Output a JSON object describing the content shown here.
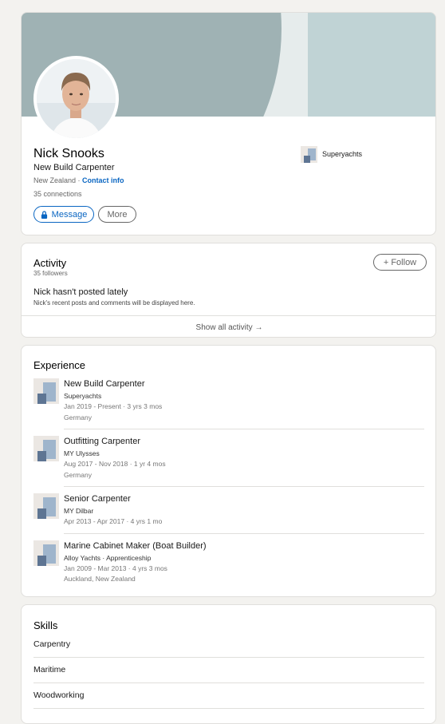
{
  "profile": {
    "name": "Nick Snooks",
    "headline": "New Build Carpenter",
    "location": "New Zealand",
    "location_separator": " · ",
    "contact_info": "Contact info",
    "connections": "35 connections",
    "message_label": "Message",
    "more_label": "More",
    "company": "Superyachts"
  },
  "activity": {
    "title": "Activity",
    "followers": "35 followers",
    "follow_label": "+ Follow",
    "no_posts_title": "Nick hasn't posted lately",
    "no_posts_text": "Nick's recent posts and comments will be displayed here.",
    "show_all": "Show all activity →"
  },
  "experience": {
    "title": "Experience",
    "items": [
      {
        "title": "New Build Carpenter",
        "company": "Superyachts",
        "dates": "Jan 2019 - Present · 3 yrs 3 mos",
        "location": "Germany"
      },
      {
        "title": "Outfitting Carpenter",
        "company": "MY Ulysses",
        "dates": "Aug 2017 - Nov 2018 · 1 yr 4 mos",
        "location": "Germany"
      },
      {
        "title": "Senior Carpenter",
        "company": "MY Dilbar",
        "dates": "Apr 2013 - Apr 2017 · 4 yrs 1 mo",
        "location": ""
      },
      {
        "title": "Marine Cabinet Maker (Boat Builder)",
        "company": "Alloy Yachts · Apprenticeship",
        "dates": "Jan 2009 - Mar 2013 · 4 yrs 3 mos",
        "location": "Auckland, New Zealand"
      }
    ]
  },
  "skills": {
    "title": "Skills",
    "items": [
      "Carpentry",
      "Maritime",
      "Woodworking"
    ]
  },
  "colors": {
    "brand_blue": "#0a66c2",
    "banner_dark": "#9fb2b4",
    "banner_light": "#c0d3d5",
    "page_bg": "#f3f2ef"
  },
  "icons": [
    "lock-icon",
    "arrow-right-icon",
    "company-logo-icon"
  ]
}
